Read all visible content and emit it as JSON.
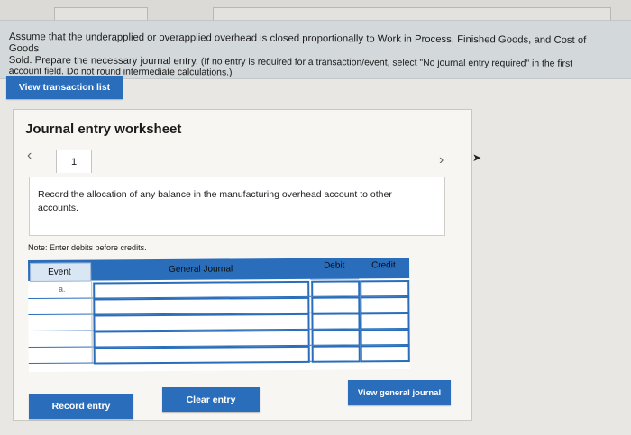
{
  "instructions": {
    "line1": "Assume that the underapplied or overapplied overhead is closed proportionally to Work in Process, Finished Goods, and Cost of Goods",
    "line2a": "Sold. Prepare the necessary journal entry.",
    "line2b": "(If no entry is required for a transaction/event, select \"No journal entry required\" in the first",
    "line3": "account field. Do not round intermediate calculations.)"
  },
  "view_transactions_label": "View transaction list",
  "worksheet": {
    "title": "Journal entry worksheet",
    "step": "1",
    "prompt": "Record the allocation of any balance in the manufacturing overhead account to other accounts.",
    "note": "Note: Enter debits before credits."
  },
  "table": {
    "headers": {
      "event": "Event",
      "account": "General Journal",
      "debit": "Debit",
      "credit": "Credit"
    },
    "rows": [
      {
        "event": "a.",
        "account": "",
        "debit": "",
        "credit": ""
      },
      {
        "event": "",
        "account": "",
        "debit": "",
        "credit": ""
      },
      {
        "event": "",
        "account": "",
        "debit": "",
        "credit": ""
      },
      {
        "event": "",
        "account": "",
        "debit": "",
        "credit": ""
      },
      {
        "event": "",
        "account": "",
        "debit": "",
        "credit": ""
      },
      {
        "event": "",
        "account": "",
        "debit": "",
        "credit": ""
      }
    ]
  },
  "buttons": {
    "record": "Record entry",
    "clear": "Clear entry",
    "view_general": "View general journal"
  },
  "icons": {
    "prev": "chevron-left-icon",
    "next": "chevron-right-icon",
    "cursor": "mouse-cursor-icon"
  },
  "colors": {
    "accent": "#2a6ebb",
    "banner": "#d3d9db"
  }
}
